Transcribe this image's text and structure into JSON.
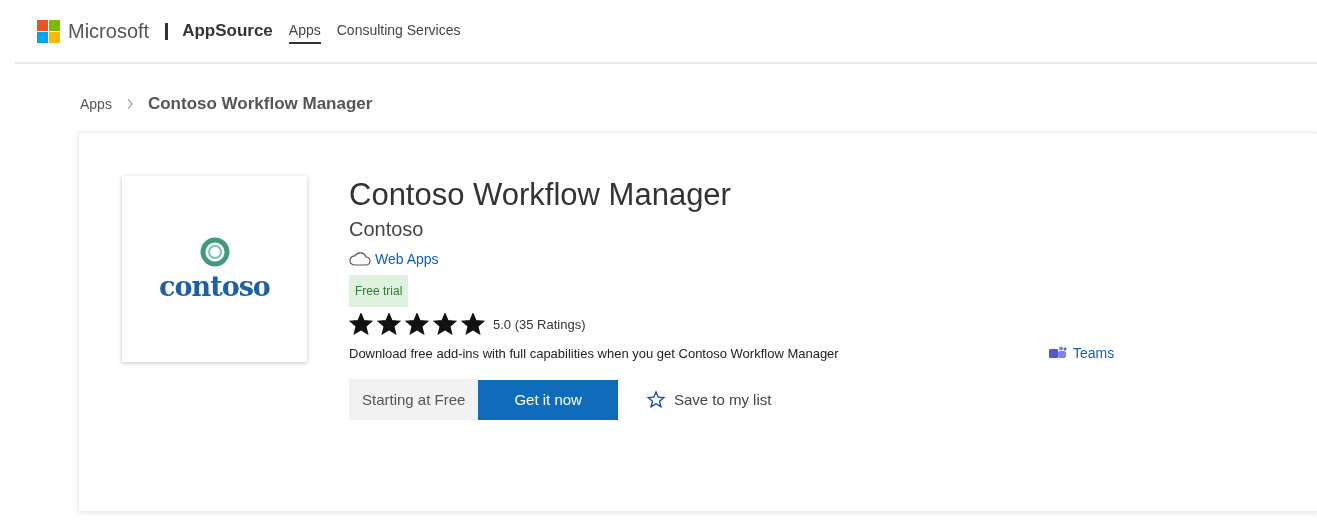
{
  "header": {
    "brand": "Microsoft",
    "product": "AppSource",
    "nav": [
      {
        "label": "Apps",
        "selected": true
      },
      {
        "label": "Consulting Services",
        "selected": false
      }
    ]
  },
  "breadcrumb": {
    "items": [
      "Apps"
    ],
    "current": "Contoso Workflow Manager"
  },
  "app": {
    "logo_text": "contoso",
    "title": "Contoso Workflow Manager",
    "publisher": "Contoso",
    "product_type": "Web Apps",
    "badge": "Free trial",
    "stars": 5,
    "rating": "5.0 (35 Ratings)",
    "description": "Download free add-ins with full capabilities when you get Contoso Workflow Manager",
    "works_with": "Teams",
    "price": "Starting at Free",
    "primary_button": "Get it now",
    "save_link": "Save to my list"
  }
}
